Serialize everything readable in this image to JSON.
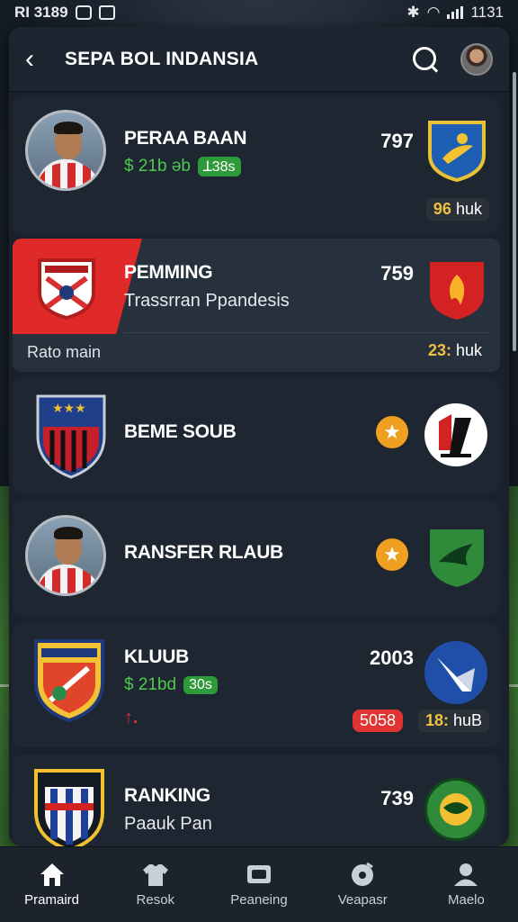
{
  "status": {
    "left": "RI 3189",
    "time": "1131"
  },
  "header": {
    "title": "SEPA BOL INDANSIA"
  },
  "cards": [
    {
      "title": "PERAA BAAN",
      "price": "$ 21b ǝb",
      "pill": "ꓕ38s",
      "number": "797",
      "tag_value": "96",
      "tag_unit": "huk"
    },
    {
      "title": "PEMMING",
      "subtitle": "Trassrran Ppandesis",
      "note": "Rato main",
      "number": "759",
      "tag_value": "23:",
      "tag_unit": "huk"
    },
    {
      "title": "BEME SOUB"
    },
    {
      "title": "RANSFER RLAUB"
    },
    {
      "title": "KLUUB",
      "price": "$ 21bd",
      "pill": "30s",
      "number": "2003",
      "red_tag": "5058",
      "tag_value": "18:",
      "tag_unit": "huB",
      "arrow": "↑."
    },
    {
      "title": "RANKING",
      "subtitle": "Paauk Pan",
      "number": "739"
    }
  ],
  "tabs": [
    {
      "label": "Pramaird",
      "icon": "home-icon"
    },
    {
      "label": "Resok",
      "icon": "jersey-icon"
    },
    {
      "label": "Peaneing",
      "icon": "ticket-icon"
    },
    {
      "label": "Veapasr",
      "icon": "ball-icon"
    },
    {
      "label": "Maelo",
      "icon": "profile-icon"
    }
  ],
  "colors": {
    "accent_red": "#e02a2a",
    "green": "#4fc94f",
    "star": "#f0a020",
    "gold": "#f0c040"
  }
}
